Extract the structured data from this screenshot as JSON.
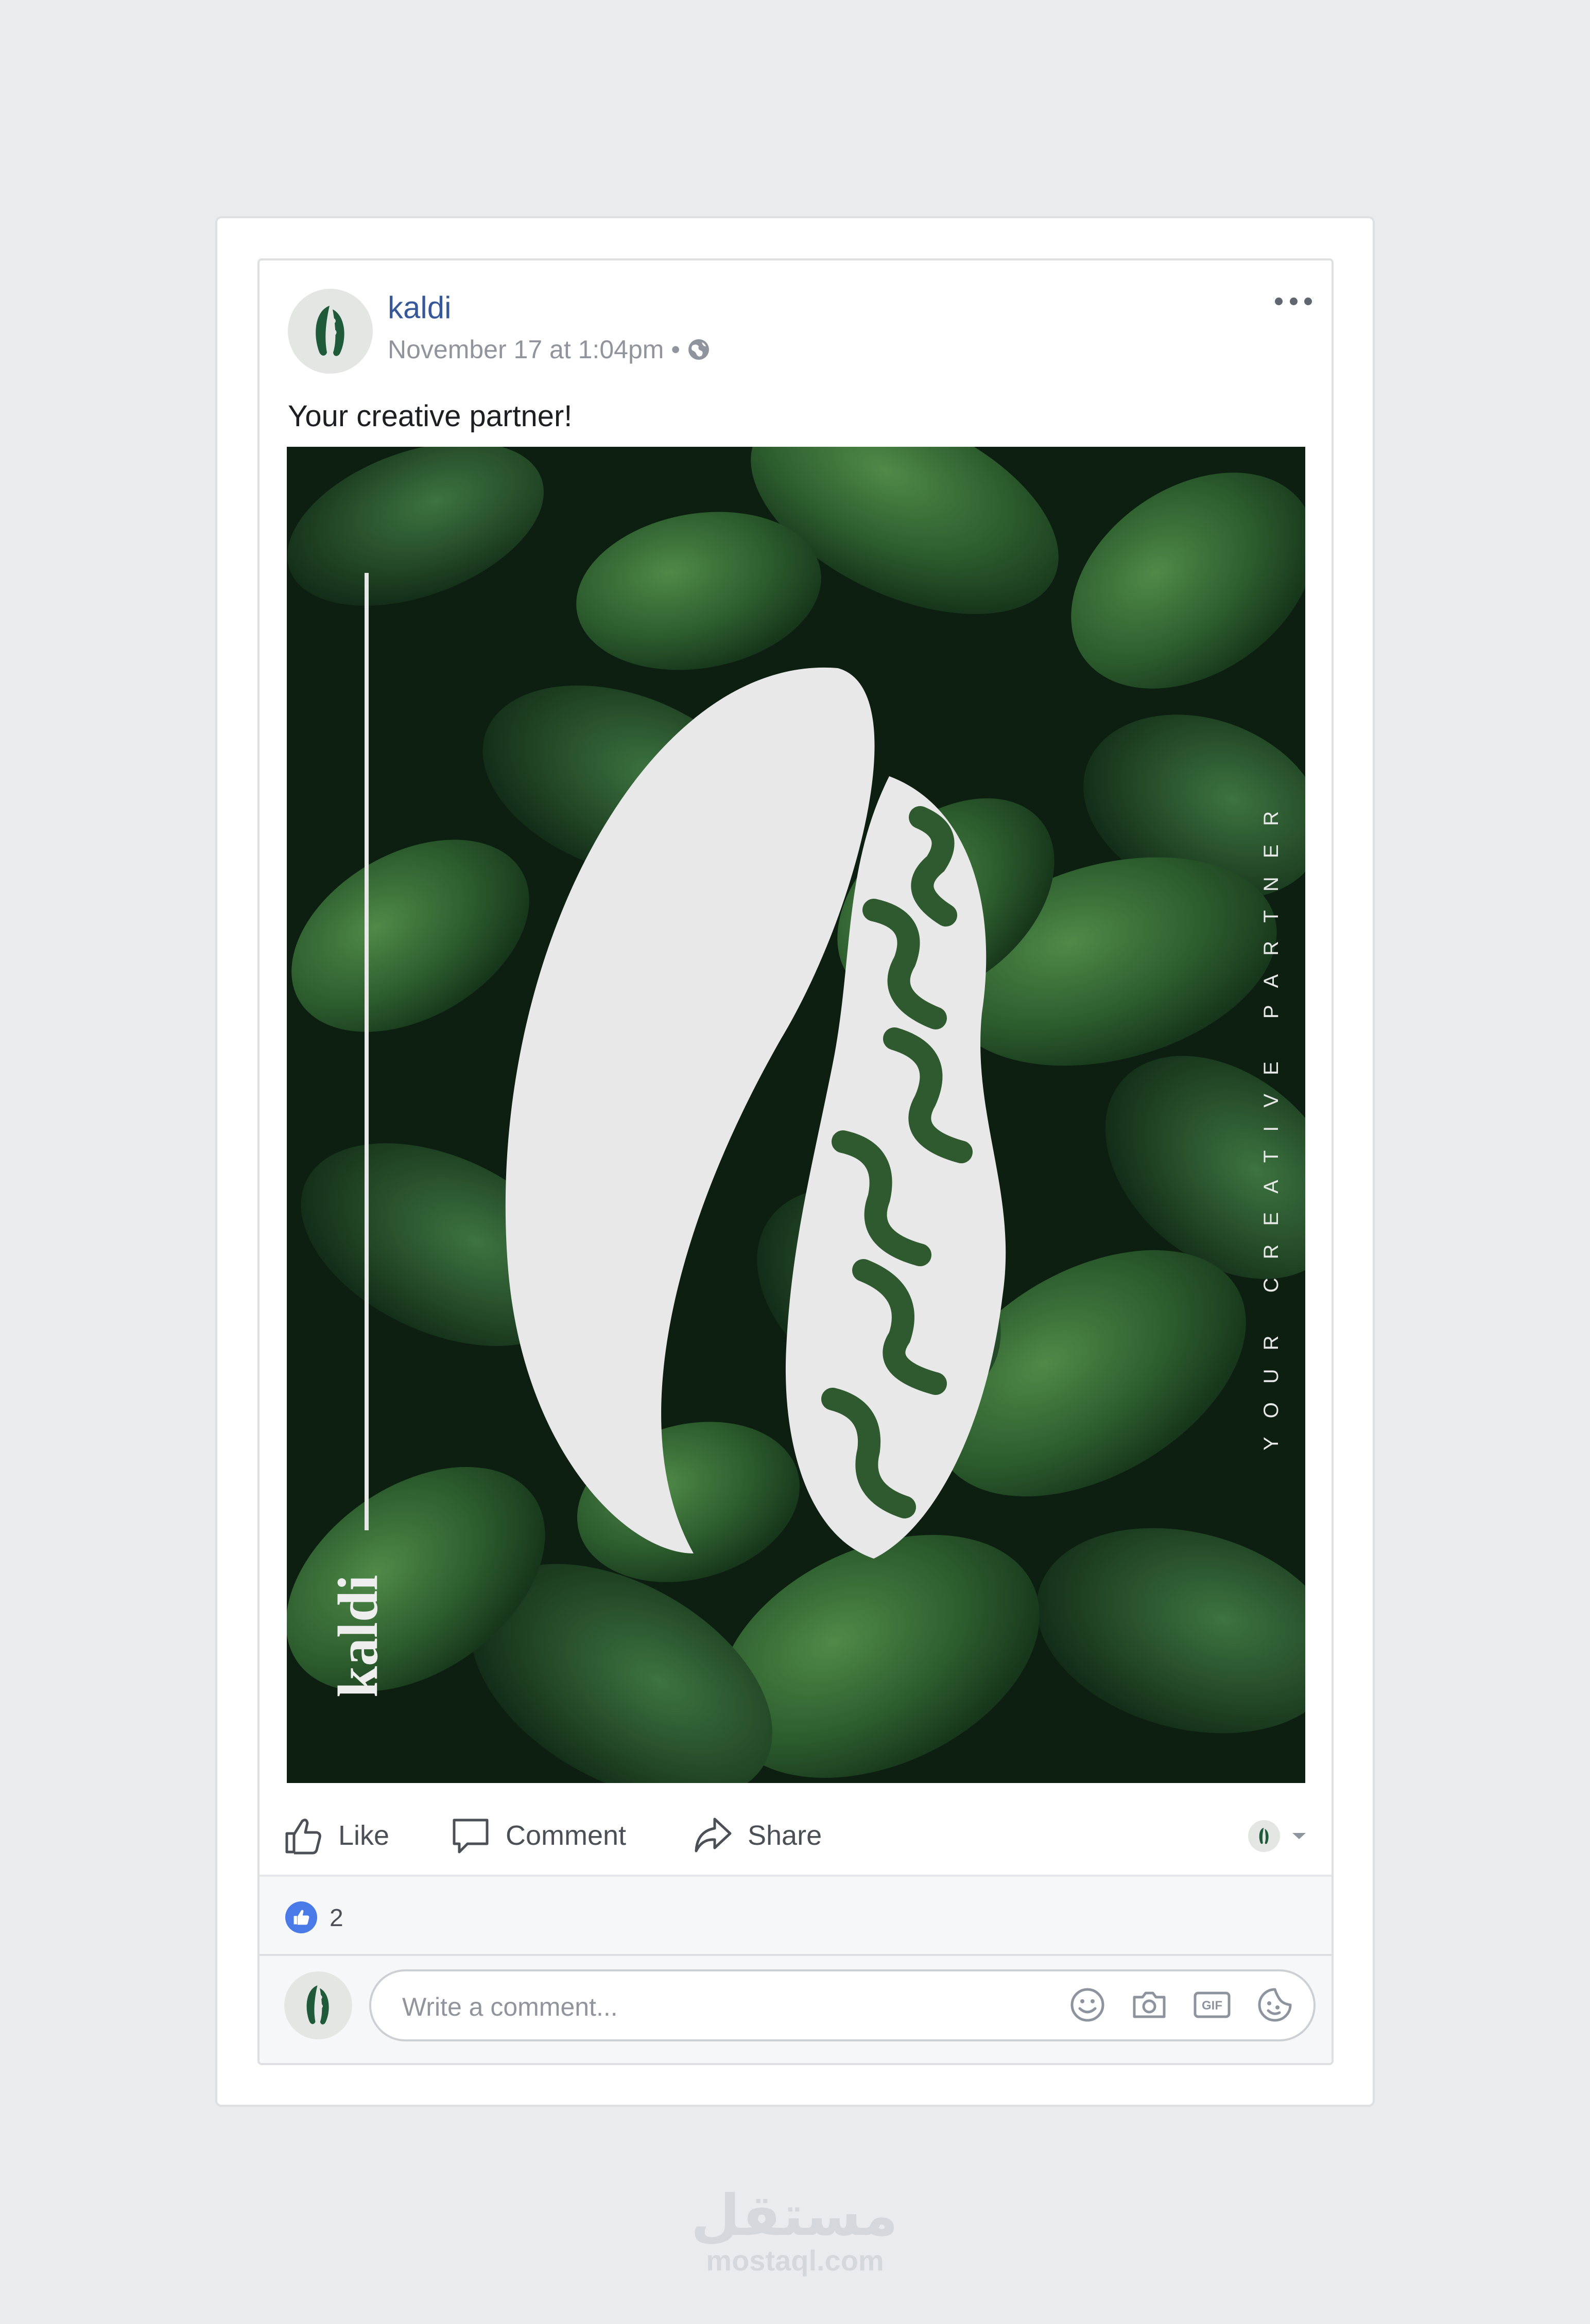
{
  "post": {
    "author": "kaldi",
    "timestamp": "November 17 at 1:04pm",
    "separator": "•",
    "audience_icon": "globe-icon",
    "more_icon": "ellipsis-icon",
    "text": "Your creative partner!",
    "image": {
      "brand_vertical": "kaldi",
      "tagline_vertical": "YOUR CREATIVE PARTNER"
    }
  },
  "actions": {
    "like_label": "Like",
    "comment_label": "Comment",
    "share_label": "Share"
  },
  "reactions": {
    "icon": "thumbs-up-icon",
    "count": "2"
  },
  "comment": {
    "placeholder": "Write a comment...",
    "tools": [
      "emoji-icon",
      "camera-icon",
      "gif-icon",
      "sticker-icon"
    ],
    "gif_label": "GIF"
  },
  "watermark": {
    "arabic": "مستقل",
    "latin": "mostaql.com"
  },
  "colors": {
    "background": "#e9ebee",
    "link_blue": "#365899",
    "like_blue": "#4a79e8",
    "leaf_dark": "#0f2414",
    "leaf_green": "#2f5a30",
    "logo_light": "#e8e8e8"
  }
}
